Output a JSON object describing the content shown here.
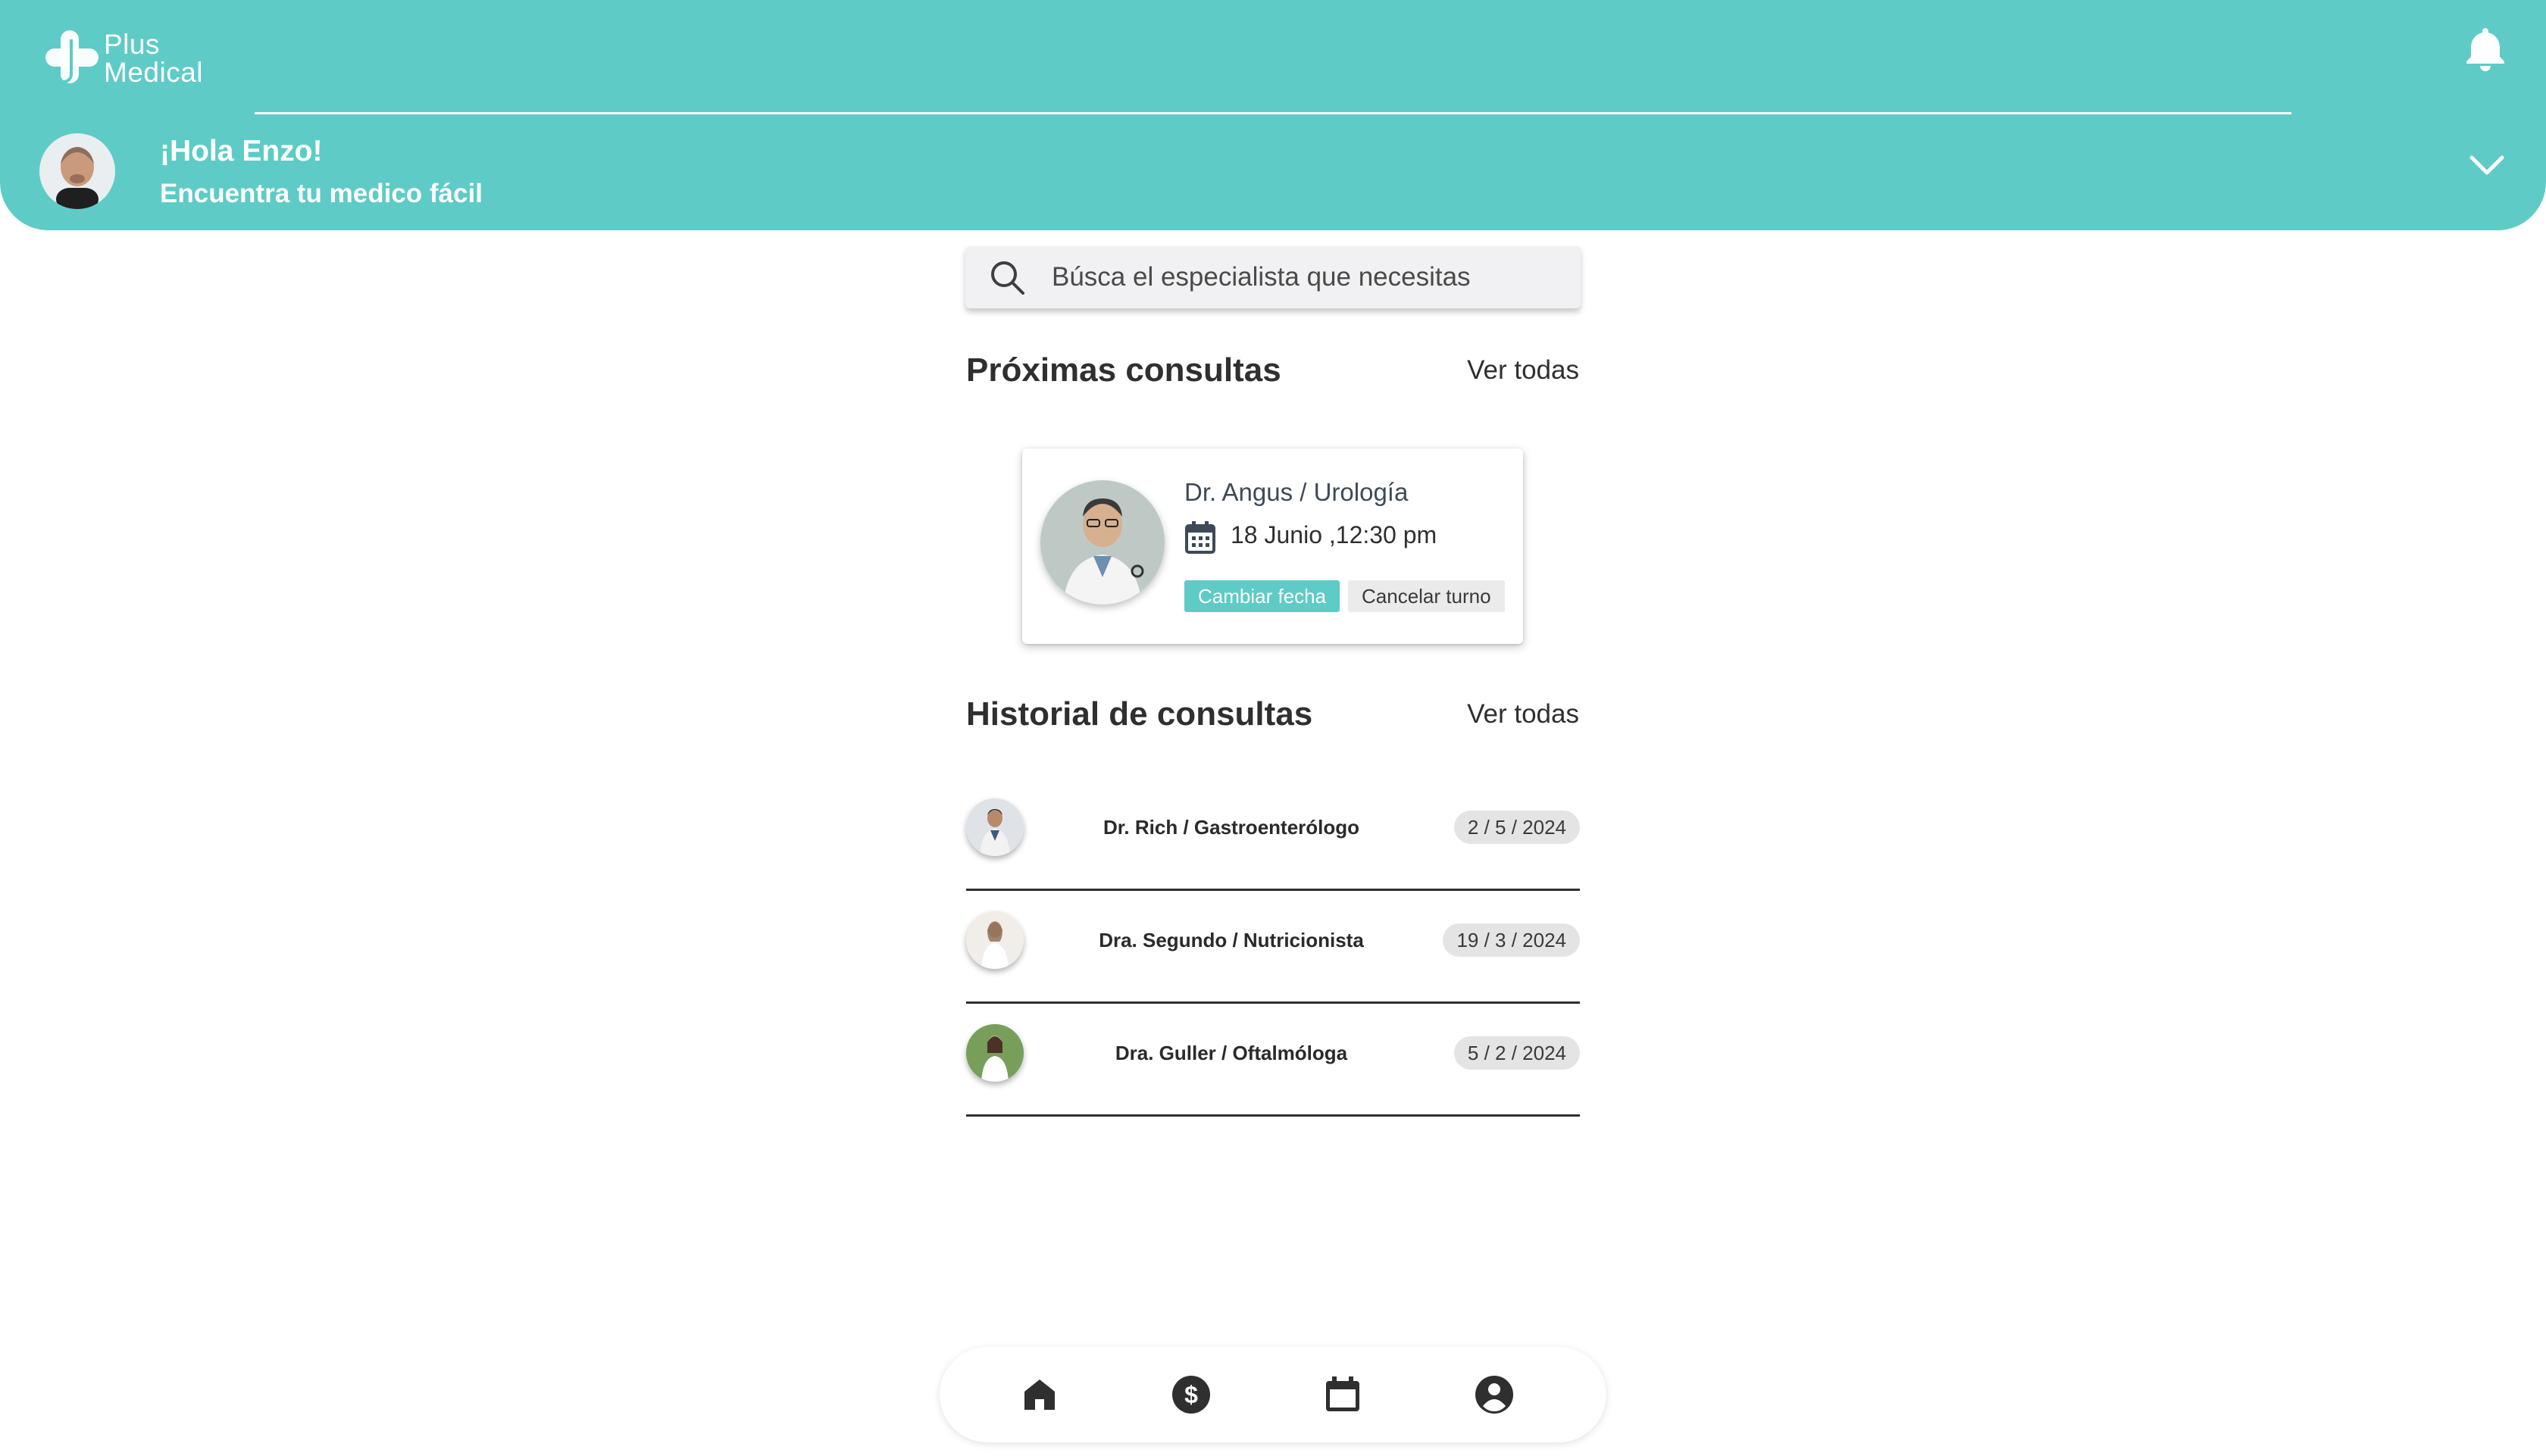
{
  "app": {
    "brand": {
      "line1": "Plus",
      "line2": "Medical"
    },
    "colors": {
      "accent": "#5ecbc6",
      "text": "#2f2f2f",
      "badge": "#e4e4e4"
    }
  },
  "header": {
    "greeting": "¡Hola Enzo!",
    "subtitle": "Encuentra tu medico fácil",
    "icons": {
      "notifications": "bell-icon",
      "expand": "chevron-down-icon"
    }
  },
  "search": {
    "placeholder": "Búsca el especialista que necesitas",
    "value": ""
  },
  "upcoming": {
    "title": "Próximas consultas",
    "see_all": "Ver todas",
    "appointment": {
      "doctor": "Dr. Angus / Urología",
      "date": "18 Junio ,12:30 pm",
      "change_label": "Cambiar fecha",
      "cancel_label": "Cancelar turno"
    }
  },
  "history": {
    "title": "Historial de consultas",
    "see_all": "Ver todas",
    "items": [
      {
        "label": "Dr. Rich / Gastroenterólogo",
        "date": "2 / 5 / 2024"
      },
      {
        "label": "Dra. Segundo / Nutricionista",
        "date": "19 / 3 / 2024"
      },
      {
        "label": "Dra. Guller / Oftalmóloga",
        "date": "5 / 2 / 2024"
      }
    ]
  },
  "bottom_nav": {
    "items": [
      {
        "icon": "home-icon",
        "active": true
      },
      {
        "icon": "dollar-icon",
        "active": false
      },
      {
        "icon": "calendar-icon",
        "active": false
      },
      {
        "icon": "account-icon",
        "active": false
      }
    ]
  }
}
